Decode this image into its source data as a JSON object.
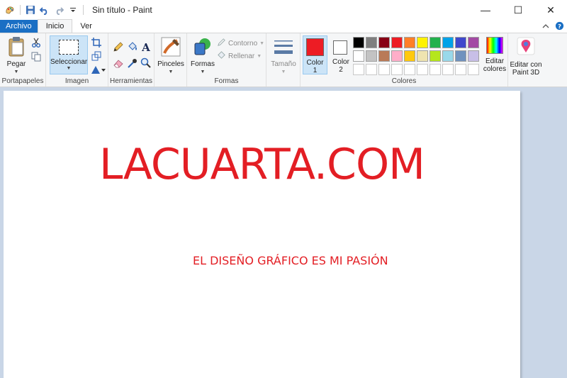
{
  "window": {
    "title": "Sin título - Paint",
    "minimize": "—",
    "maximize": "☐",
    "close": "✕"
  },
  "tabs": {
    "file": "Archivo",
    "home": "Inicio",
    "view": "Ver"
  },
  "ribbon": {
    "groups": {
      "clipboard": "Portapapeles",
      "image": "Imagen",
      "tools": "Herramientas",
      "shapes": "Formas",
      "colors": "Colores"
    },
    "paste": "Pegar",
    "select": "Seleccionar",
    "brushes": "Pinceles",
    "shapes_btn": "Formas",
    "outline": "Contorno",
    "fill": "Rellenar",
    "size": "Tamaño",
    "color1_a": "Color",
    "color1_b": "1",
    "color2_a": "Color",
    "color2_b": "2",
    "edit_colors_a": "Editar",
    "edit_colors_b": "colores",
    "paint3d_a": "Editar con",
    "paint3d_b": "Paint 3D",
    "color1_value": "#ed1c24",
    "color2_value": "#ffffff"
  },
  "palette": [
    "#000000",
    "#7f7f7f",
    "#880015",
    "#ed1c24",
    "#ff7f27",
    "#fff200",
    "#22b14c",
    "#00a2e8",
    "#3f48cc",
    "#a349a4",
    "#ffffff",
    "#c3c3c3",
    "#b97a57",
    "#ffaec9",
    "#ffc90e",
    "#efe4b0",
    "#b5e61d",
    "#99d9ea",
    "#7092be",
    "#c8bfe7",
    "",
    "",
    "",
    "",
    "",
    "",
    "",
    "",
    "",
    ""
  ],
  "canvas": {
    "title": "LACUARTA.COM",
    "subtitle": "EL DISEÑO GRÁFICO ES MI PASIÓN",
    "text_color": "#e31e24"
  }
}
